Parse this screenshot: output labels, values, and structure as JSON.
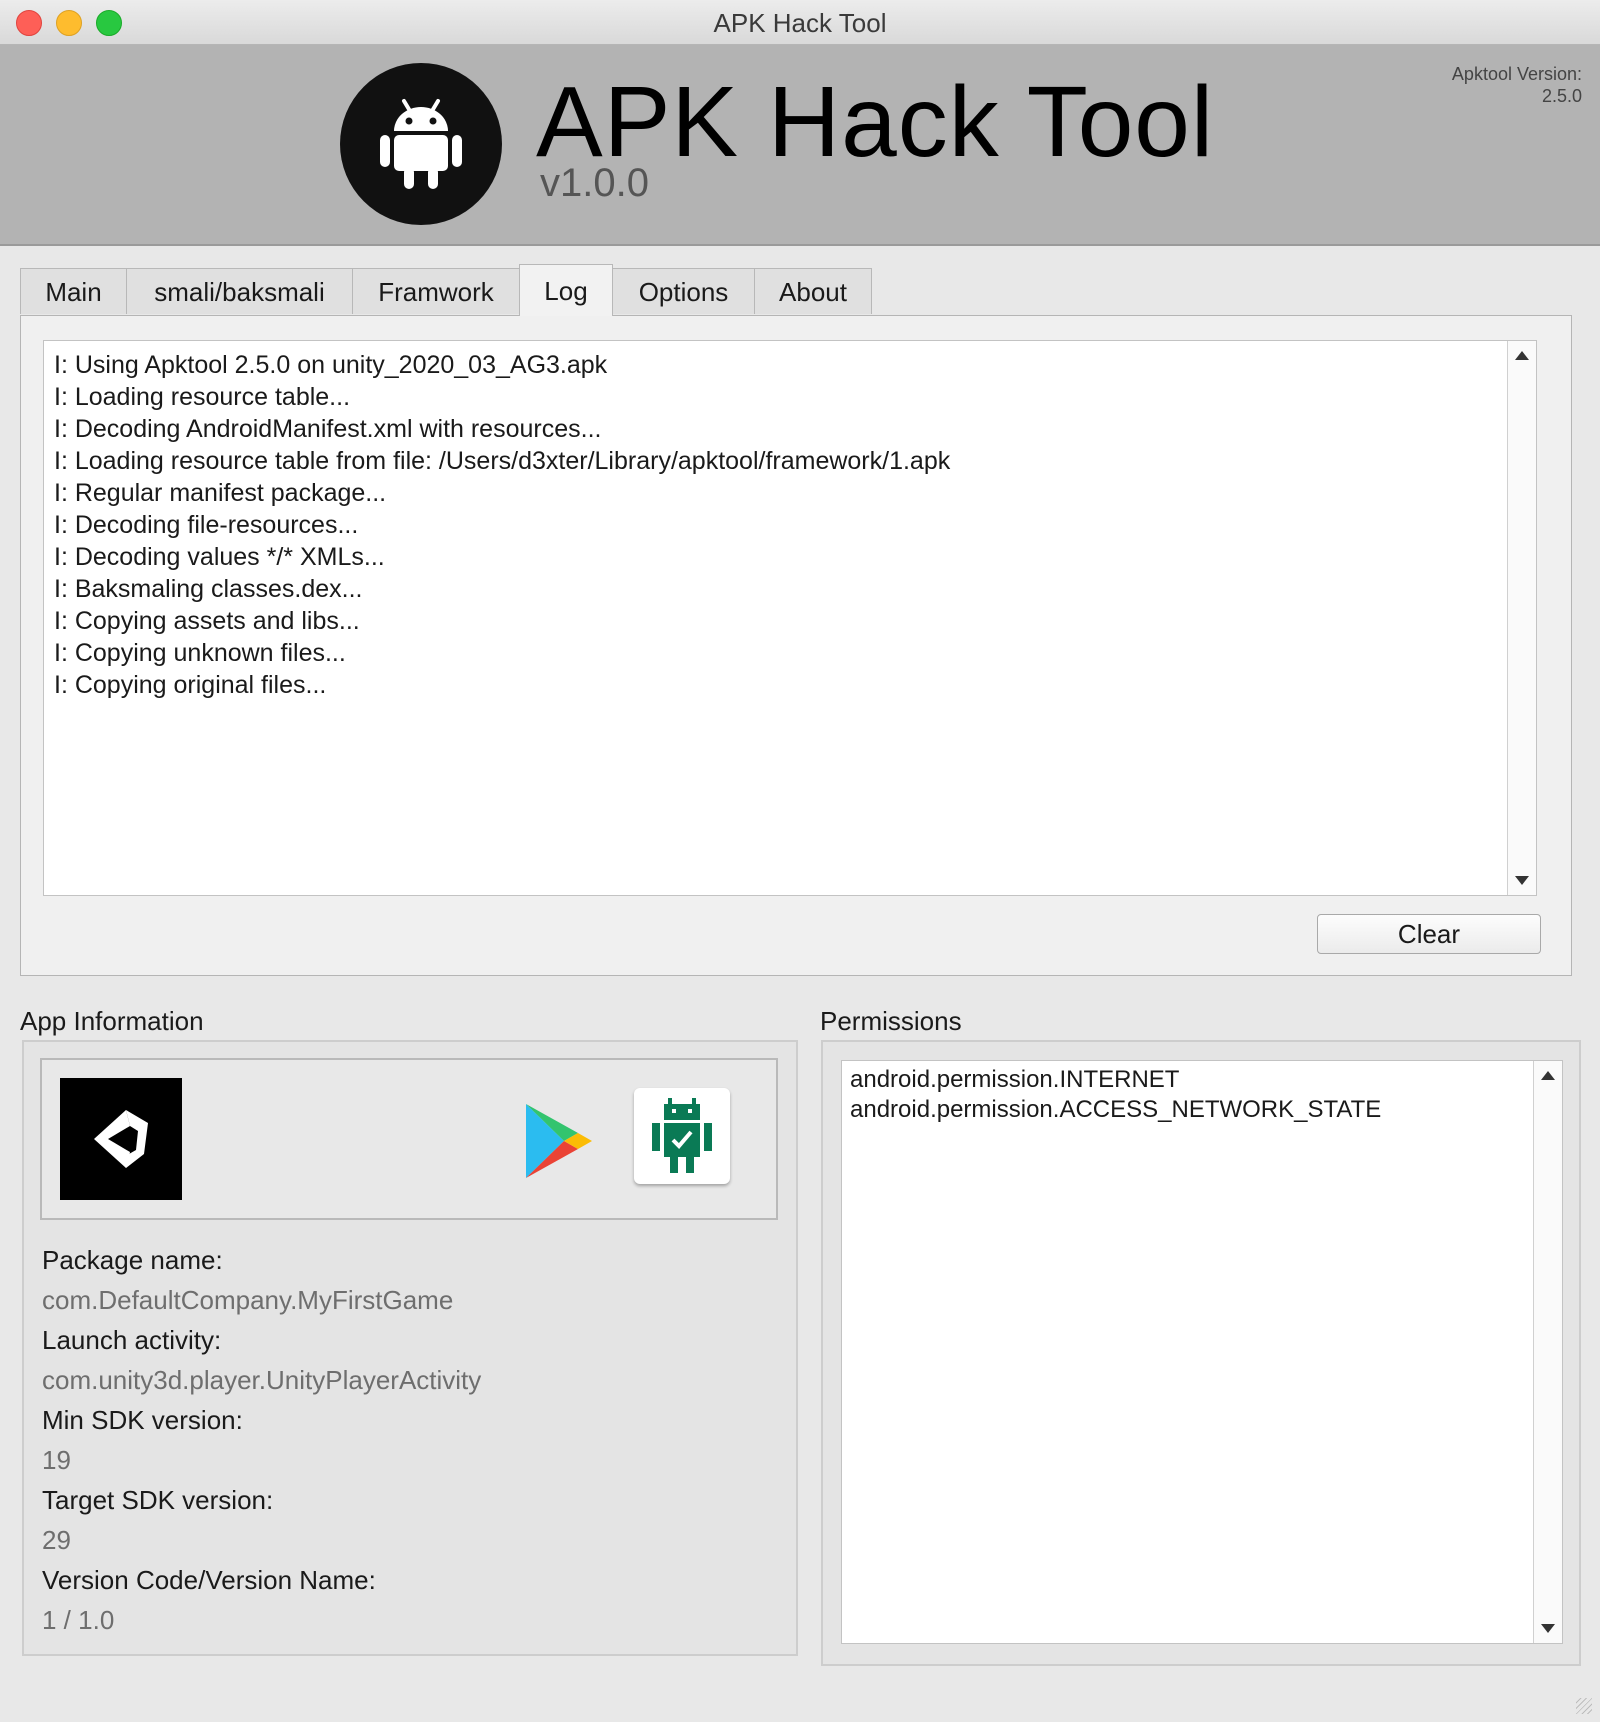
{
  "window": {
    "title": "APK Hack Tool"
  },
  "banner": {
    "app_name": "APK Hack Tool",
    "app_version": "v1.0.0",
    "apktool_label": "Apktool Version:",
    "apktool_version": "2.5.0",
    "logo_icon": "android-robot-icon"
  },
  "tabs": [
    {
      "label": "Main"
    },
    {
      "label": "smali/baksmali"
    },
    {
      "label": "Framwork"
    },
    {
      "label": "Log",
      "active": true
    },
    {
      "label": "Options"
    },
    {
      "label": "About"
    }
  ],
  "log": {
    "lines": [
      "I: Using Apktool 2.5.0 on unity_2020_03_AG3.apk",
      "I: Loading resource table...",
      "I: Decoding AndroidManifest.xml with resources...",
      "I: Loading resource table from file: /Users/d3xter/Library/apktool/framework/1.apk",
      "I: Regular manifest package...",
      "I: Decoding file-resources...",
      "I: Decoding values */* XMLs...",
      "I: Baksmaling classes.dex...",
      "I: Copying assets and libs...",
      "I: Copying unknown files...",
      "I: Copying original files..."
    ],
    "clear_label": "Clear"
  },
  "app_info": {
    "title": "App Information",
    "icons": [
      "unity-icon",
      "google-play-icon",
      "android-app-icon"
    ],
    "package_label": "Package name:",
    "package_value": "com.DefaultCompany.MyFirstGame",
    "launch_label": "Launch activity:",
    "launch_value": "com.unity3d.player.UnityPlayerActivity",
    "minsdk_label": "Min SDK version:",
    "minsdk_value": "19",
    "targetsdk_label": "Target SDK version:",
    "targetsdk_value": "29",
    "version_label": "Version Code/Version Name:",
    "version_value": "1 / 1.0"
  },
  "permissions": {
    "title": "Permissions",
    "items": [
      "android.permission.INTERNET",
      "android.permission.ACCESS_NETWORK_STATE"
    ]
  },
  "colors": {
    "banner_bg": "#b3b3b3",
    "close": "#fe5f57",
    "minimize": "#febc2e",
    "zoom": "#28c840",
    "android_green": "#0a7a55"
  }
}
